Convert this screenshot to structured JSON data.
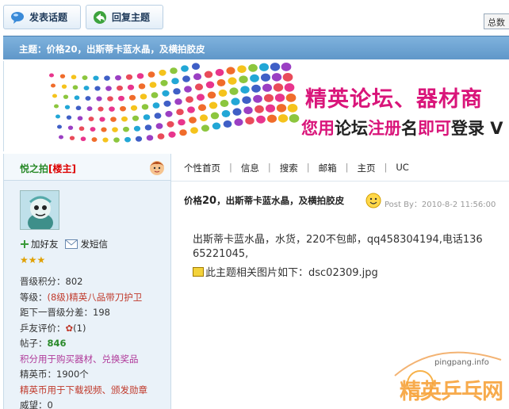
{
  "toolbar": {
    "post_label": "发表话题",
    "reply_label": "回复主题",
    "total_label": "总数"
  },
  "topic": {
    "label": "主题：价格20，出斯蒂卡蓝水晶，及横拍胶皮"
  },
  "banner": {
    "line1": "精英论坛、器材商",
    "line2_a": "您用",
    "line2_b": "论坛",
    "line2_c": "注册",
    "line2_d": "名",
    "line2_e": "即可",
    "line2_f": "登录 V"
  },
  "user": {
    "name": "悦之拍",
    "role": "[楼主]",
    "add_friend": "加好友",
    "send_msg": "发短信",
    "stars": "★★★",
    "stats": {
      "level_score": "晋级积分：802",
      "rank_prefix": "等级：",
      "rank_value": "(8级)精英八品带刀护卫",
      "next_rank": "距下一晋级分差：198",
      "rating_label": "乒友评价：",
      "rating_value": "(1)",
      "posts_label": "帖子：",
      "posts_value": "846",
      "points_note": "积分用于购买器材、兑换奖品",
      "coins": "精英币：1900个",
      "coins_note": "精英币用于下载视频、颁发勋章",
      "more": "威望：0"
    }
  },
  "nav": [
    "个性首页",
    "信息",
    "搜索",
    "邮箱",
    "主页",
    "UC"
  ],
  "post": {
    "title_a": "价格",
    "title_num": "20",
    "title_b": "，出斯蒂卡蓝水晶，及横拍胶皮",
    "by": "Post By：2010-8-2 11:56:00",
    "line1": "出斯蒂卡蓝水晶，水货，220不包邮，qq458304194,电话136",
    "line2": "65221045,",
    "attach_label": "此主题相关图片如下：dsc02309.jpg"
  },
  "watermark": {
    "site": "pingpang.info",
    "brand": "精英乒乓网"
  },
  "colors": {
    "topic_bar": "#6fa4d3",
    "brand_pink": "#d9157a",
    "username_green": "#2a8a2a"
  }
}
